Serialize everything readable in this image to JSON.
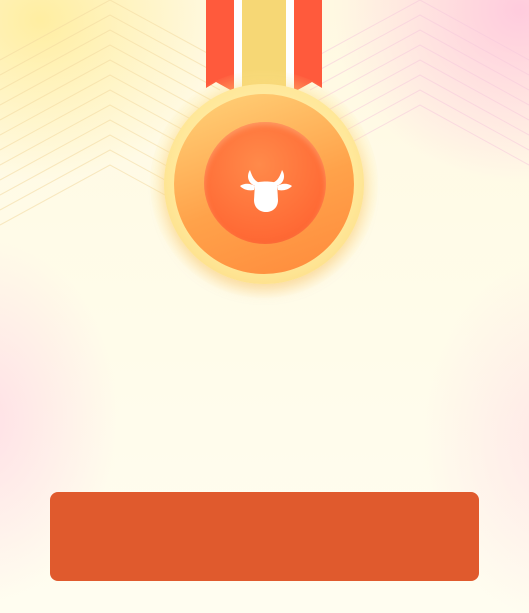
{
  "colors": {
    "accent": "#e05a2d",
    "medal_gold": "#ffe89a",
    "medal_orange": "#ff8a3c",
    "ribbon_red": "#ff5a3c",
    "ribbon_gold": "#f6d775"
  },
  "medal": {
    "icon": "bull-icon"
  },
  "action_button": {
    "label": ""
  }
}
